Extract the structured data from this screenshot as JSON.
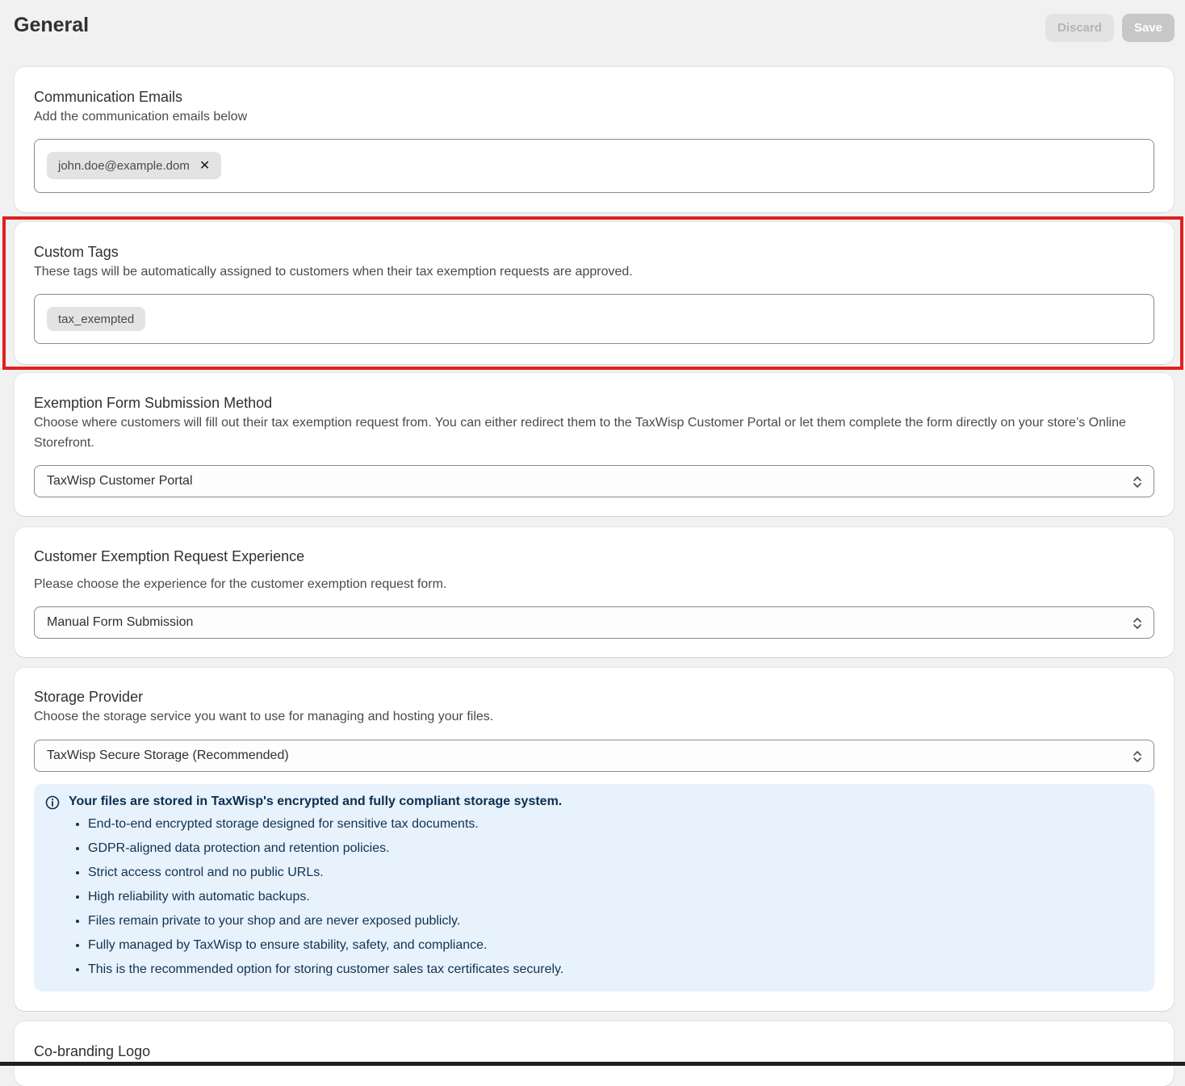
{
  "header": {
    "title": "General",
    "discard_label": "Discard",
    "save_label": "Save"
  },
  "communication_emails": {
    "title": "Communication Emails",
    "description": "Add the communication emails below",
    "tags": [
      "john.doe@example.dom"
    ],
    "remove_icon": "close-icon"
  },
  "custom_tags": {
    "title": "Custom Tags",
    "description": "These tags will be automatically assigned to customers when their tax exemption requests are approved.",
    "tags": [
      "tax_exempted"
    ],
    "highlight_color": "#e0201f"
  },
  "submission_method": {
    "title": "Exemption Form Submission Method",
    "description": "Choose where customers will fill out their tax exemption request from. You can either redirect them to the TaxWisp Customer Portal or let them complete the form directly on your store’s Online Storefront.",
    "selected": "TaxWisp Customer Portal"
  },
  "request_experience": {
    "title": "Customer Exemption Request Experience",
    "description": "Please choose the experience for the customer exemption request form.",
    "selected": "Manual Form Submission"
  },
  "storage_provider": {
    "title": "Storage Provider",
    "description": "Choose the storage service you want to use for managing and hosting your files.",
    "selected": "TaxWisp Secure Storage (Recommended)",
    "info": {
      "icon": "info-icon",
      "title": "Your files are stored in TaxWisp's encrypted and fully compliant storage system.",
      "items": [
        "End-to-end encrypted storage designed for sensitive tax documents.",
        "GDPR-aligned data protection and retention policies.",
        "Strict access control and no public URLs.",
        "High reliability with automatic backups.",
        "Files remain private to your shop and are never exposed publicly.",
        "Fully managed by TaxWisp to ensure stability, safety, and compliance.",
        "This is the recommended option for storing customer sales tax certificates securely."
      ]
    }
  },
  "cobranding": {
    "title": "Co-branding Logo"
  }
}
